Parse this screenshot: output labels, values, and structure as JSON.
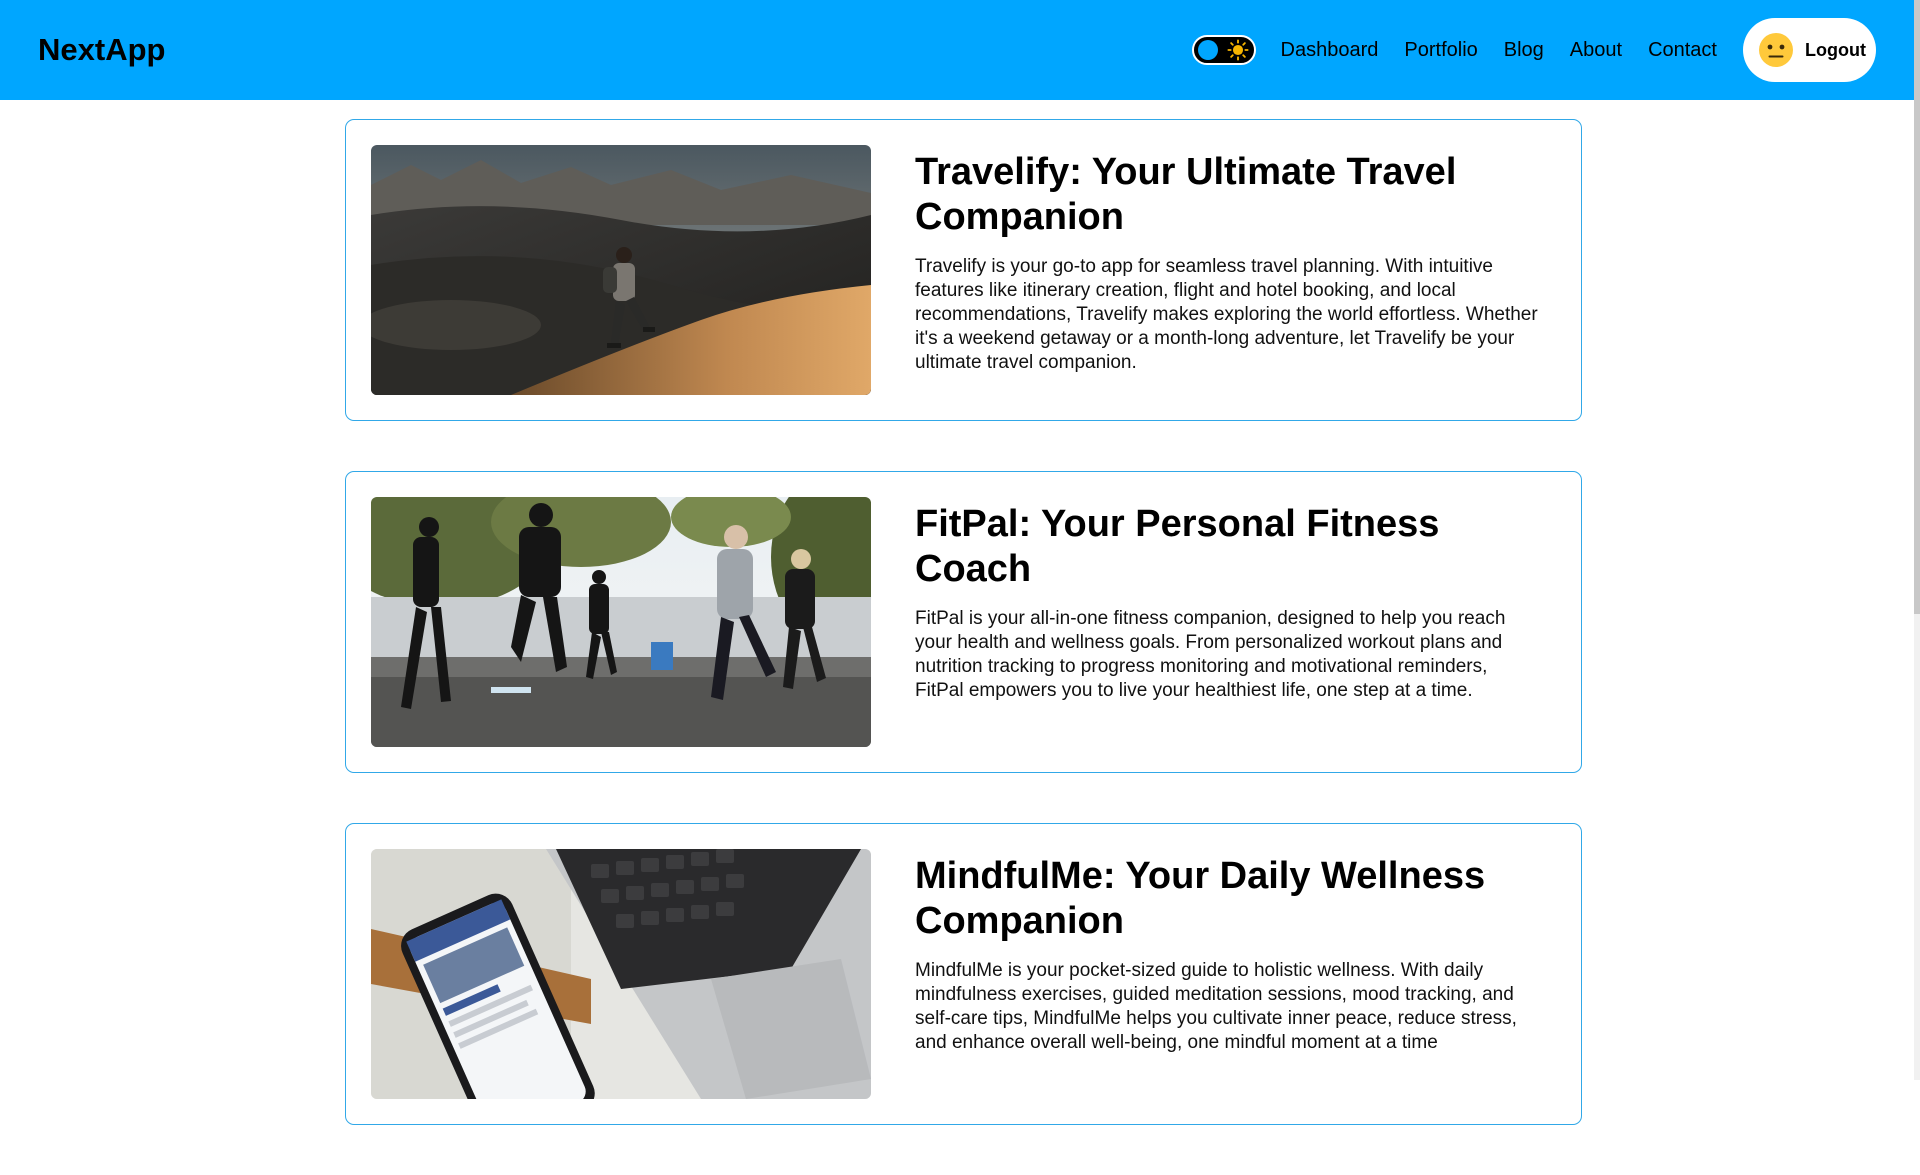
{
  "header": {
    "brand": "NextApp",
    "theme_toggle": {
      "state": "dark",
      "sun_icon": "sun-icon"
    },
    "nav_links": [
      "Dashboard",
      "Portfolio",
      "Blog",
      "About",
      "Contact"
    ],
    "logout_label": "Logout",
    "avatar_icon": "neutral-face-emoji-icon"
  },
  "colors": {
    "header_bg": "#00a6ff",
    "card_border": "#31a8e8",
    "page_bg": "#ffffff"
  },
  "projects": [
    {
      "title": "Travelify: Your Ultimate Travel Companion",
      "description": "Travelify is your go-to app for seamless travel planning. With intuitive features like itinerary creation, flight and hotel booking, and local recommendations, Travelify makes exploring the world effortless. Whether it's a weekend getaway or a month-long adventure, let Travelify be your ultimate travel companion.",
      "image": "hiker-on-desert-dunes-photo"
    },
    {
      "title": "FitPal: Your Personal Fitness Coach",
      "description": "FitPal is your all-in-one fitness companion, designed to help you reach your health and wellness goals. From personalized workout plans and nutrition tracking to progress monitoring and motivational reminders, FitPal empowers you to live your healthiest life, one step at a time.",
      "image": "group-outdoor-workout-photo"
    },
    {
      "title": "MindfulMe: Your Daily Wellness Companion",
      "description": "MindfulMe is your pocket-sized guide to holistic wellness. With daily mindfulness exercises, guided meditation sessions, mood tracking, and self-care tips, MindfulMe helps you cultivate inner peace, reduce stress, and enhance overall well-being, one mindful moment at a time",
      "image": "phone-on-laptop-photo"
    }
  ]
}
